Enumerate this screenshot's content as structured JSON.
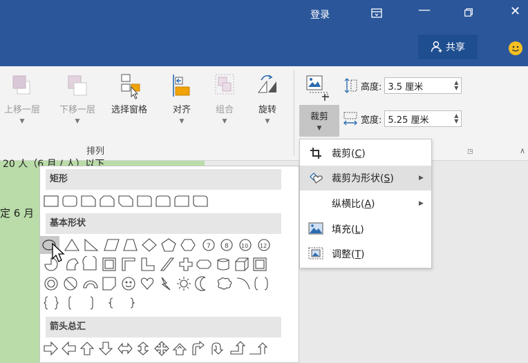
{
  "titlebar": {
    "login": "登录",
    "minimize": "—",
    "close": "✕",
    "share": "共享"
  },
  "ribbon": {
    "buttons": [
      {
        "label": "上移一层",
        "enabled": false
      },
      {
        "label": "下移一层",
        "enabled": false
      },
      {
        "label": "选择窗格",
        "enabled": true
      },
      {
        "label": "对齐",
        "enabled": true
      },
      {
        "label": "组合",
        "enabled": false
      },
      {
        "label": "旋转",
        "enabled": true
      }
    ],
    "group_label": "排列",
    "crop_label": "裁剪",
    "height_label": "高度:",
    "height_value": "3.5 厘米",
    "width_label": "宽度:",
    "width_value": "5.25 厘米"
  },
  "document": {
    "text1": "20 人（6 月 / 人）以下",
    "text2": "定 6 月"
  },
  "gallery": {
    "categories": [
      "矩形",
      "基本形状",
      "箭头总汇"
    ]
  },
  "crop_menu": {
    "items": [
      {
        "label": "裁剪",
        "key": "C",
        "submenu": false,
        "highlighted": false
      },
      {
        "label": "裁剪为形状",
        "key": "S",
        "submenu": true,
        "highlighted": true
      },
      {
        "label": "纵横比",
        "key": "A",
        "submenu": true,
        "highlighted": false
      },
      {
        "label": "填充",
        "key": "L",
        "submenu": false,
        "highlighted": false
      },
      {
        "label": "调整",
        "key": "T",
        "submenu": false,
        "highlighted": false
      }
    ]
  },
  "colors": {
    "titlebar": "#2b579a",
    "doc_green": "#b9dca8",
    "accent_orange": "#f0a30a"
  }
}
